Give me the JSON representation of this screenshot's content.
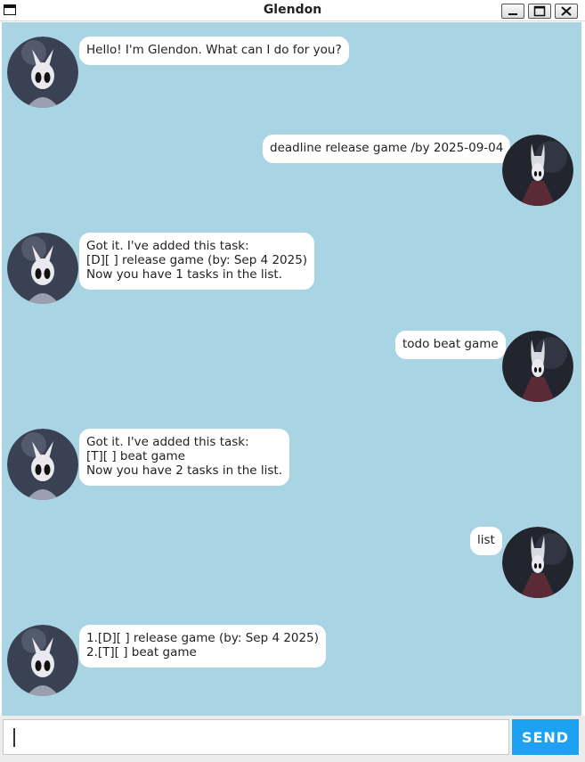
{
  "window": {
    "title": "Glendon"
  },
  "colors": {
    "chat_background": "#a9d4e4",
    "bubble": "#ffffff",
    "send_button": "#1da1f2"
  },
  "messages": [
    {
      "sender": "bot",
      "text": "Hello! I'm Glendon. What can I do for you?",
      "avatar": "knight-icon"
    },
    {
      "sender": "user",
      "text": "deadline release game /by 2025-09-04",
      "avatar": "hornet-icon"
    },
    {
      "sender": "bot",
      "text": "Got it. I've added this task:\n[D][ ] release game (by: Sep 4 2025)\nNow you have 1 tasks in the list.",
      "avatar": "knight-icon"
    },
    {
      "sender": "user",
      "text": "todo beat game",
      "avatar": "hornet-icon"
    },
    {
      "sender": "bot",
      "text": "Got it. I've added this task:\n[T][ ] beat game\nNow you have 2 tasks in the list.",
      "avatar": "knight-icon"
    },
    {
      "sender": "user",
      "text": "list",
      "avatar": "hornet-icon"
    },
    {
      "sender": "bot",
      "text": "1.[D][ ] release game (by: Sep 4 2025)\n2.[T][ ] beat game",
      "avatar": "knight-icon"
    }
  ],
  "input": {
    "value": "",
    "placeholder": ""
  },
  "send_label": "SEND"
}
